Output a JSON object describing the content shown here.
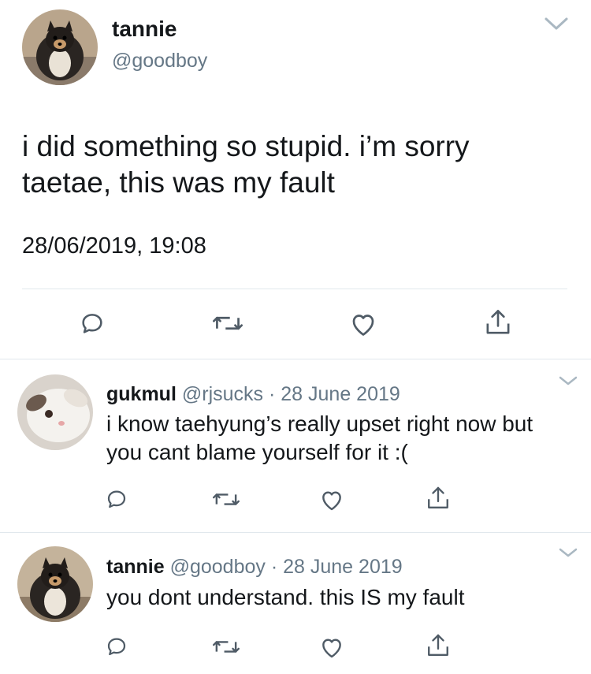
{
  "main_tweet": {
    "display_name": "tannie",
    "handle": "@goodboy",
    "text_line1": "i did something so stupid. i’m sorry",
    "text_line2": "taetae, this was my fault",
    "timestamp": "28/06/2019, 19:08",
    "avatar_icon": "pomeranian-dog-avatar",
    "actions": [
      "reply-icon",
      "retweet-icon",
      "like-icon",
      "share-icon"
    ]
  },
  "replies": [
    {
      "display_name": "gukmul",
      "handle": "@rjsucks",
      "separator": "·",
      "date": "28 June 2019",
      "text_line1": "i know taehyung’s really upset right now but",
      "text_line2": "you cant blame yourself for it :(",
      "avatar_icon": "white-rabbit-avatar"
    },
    {
      "display_name": "tannie",
      "handle": "@goodboy",
      "separator": "·",
      "date": "28 June 2019",
      "text_line1": "you dont understand. this IS my fault",
      "avatar_icon": "pomeranian-dog-avatar"
    }
  ],
  "colors": {
    "text": "#14171a",
    "muted": "#657786",
    "divider": "#e1e8ed",
    "icon": "#4f5b66"
  }
}
